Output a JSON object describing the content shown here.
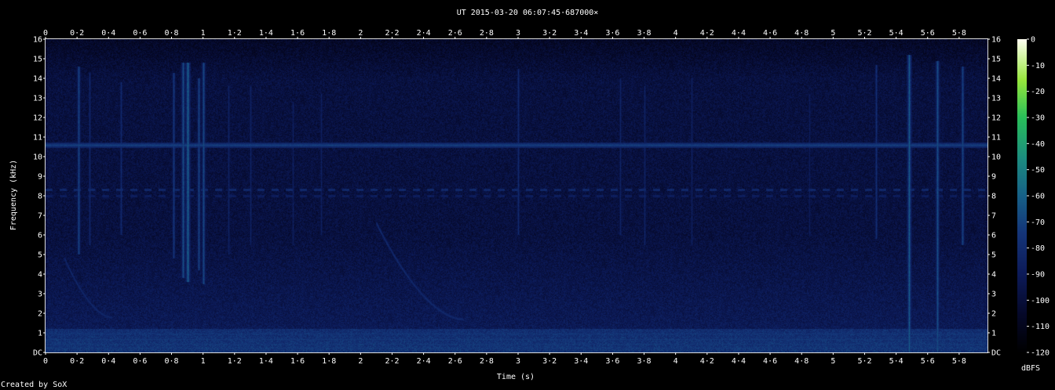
{
  "chart_data": {
    "type": "heatmap",
    "title": "UT 2015-03-20 06:07:45·687000×",
    "xlabel": "Time (s)",
    "ylabel": "Frequency (kHz)",
    "xlim": [
      0,
      5.98
    ],
    "ylim": [
      0,
      16
    ],
    "x_ticks": [
      "0",
      "0·2",
      "0·4",
      "0·6",
      "0·8",
      "1",
      "1·2",
      "1·4",
      "1·6",
      "1·8",
      "2",
      "2·2",
      "2·4",
      "2·6",
      "2·8",
      "3",
      "3·2",
      "3·4",
      "3·6",
      "3·8",
      "4",
      "4·2",
      "4·4",
      "4·6",
      "4·8",
      "5",
      "5·2",
      "5·4",
      "5·6",
      "5·8"
    ],
    "y_ticks": [
      "DC",
      "1",
      "2",
      "3",
      "4",
      "5",
      "6",
      "7",
      "8",
      "9",
      "10",
      "11",
      "12",
      "13",
      "14",
      "15",
      "16"
    ],
    "colorbar": {
      "label": "dBFS",
      "range": [
        -120,
        0
      ],
      "ticks": [
        "0",
        "-10",
        "-20",
        "-30",
        "-40",
        "-50",
        "-60",
        "-70",
        "-80",
        "-90",
        "-100",
        "-110",
        "-120"
      ]
    },
    "features": {
      "background_dbfs": -98,
      "carrier_line": {
        "freq_khz": 10.6,
        "level_dbfs": -72
      },
      "dashed_lines": [
        {
          "freq_khz": 8.3,
          "level_dbfs": -82
        },
        {
          "freq_khz": 8.0,
          "level_dbfs": -88
        }
      ],
      "low_band": {
        "freq_khz": [
          0,
          1.2
        ],
        "level_dbfs": -78
      },
      "vertical_bursts": [
        {
          "t": 0.21,
          "f_min": 5,
          "f_max": 14.6,
          "level_dbfs": -70
        },
        {
          "t": 0.28,
          "f_min": 5.5,
          "f_max": 14.3,
          "level_dbfs": -82
        },
        {
          "t": 0.48,
          "f_min": 6,
          "f_max": 13.8,
          "level_dbfs": -80
        },
        {
          "t": 0.81,
          "f_min": 4.8,
          "f_max": 14.3,
          "level_dbfs": -74
        },
        {
          "t": 0.87,
          "f_min": 3.8,
          "f_max": 14.8,
          "level_dbfs": -66
        },
        {
          "t": 0.9,
          "f_min": 3.6,
          "f_max": 14.8,
          "level_dbfs": -60
        },
        {
          "t": 0.97,
          "f_min": 4.2,
          "f_max": 14,
          "level_dbfs": -70
        },
        {
          "t": 1.0,
          "f_min": 3.5,
          "f_max": 14.8,
          "level_dbfs": -68
        },
        {
          "t": 1.16,
          "f_min": 5,
          "f_max": 13.6,
          "level_dbfs": -84
        },
        {
          "t": 1.3,
          "f_min": 5.5,
          "f_max": 13.6,
          "level_dbfs": -84
        },
        {
          "t": 1.57,
          "f_min": 5.5,
          "f_max": 12.8,
          "level_dbfs": -86
        },
        {
          "t": 1.75,
          "f_min": 6,
          "f_max": 13.2,
          "level_dbfs": -86
        },
        {
          "t": 3.0,
          "f_min": 6,
          "f_max": 14.5,
          "level_dbfs": -80
        },
        {
          "t": 3.65,
          "f_min": 6,
          "f_max": 14,
          "level_dbfs": -84
        },
        {
          "t": 3.8,
          "f_min": 5.5,
          "f_max": 13.6,
          "level_dbfs": -84
        },
        {
          "t": 4.1,
          "f_min": 5.5,
          "f_max": 14,
          "level_dbfs": -86
        },
        {
          "t": 4.85,
          "f_min": 6,
          "f_max": 13.2,
          "level_dbfs": -88
        },
        {
          "t": 5.27,
          "f_min": 5.8,
          "f_max": 14.7,
          "level_dbfs": -78
        },
        {
          "t": 5.48,
          "f_min": 0,
          "f_max": 15.2,
          "level_dbfs": -62
        },
        {
          "t": 5.66,
          "f_min": 0,
          "f_max": 14.9,
          "level_dbfs": -66
        },
        {
          "t": 5.82,
          "f_min": 5.5,
          "f_max": 14.6,
          "level_dbfs": -70
        }
      ],
      "sweeps": [
        {
          "t_start": 0.12,
          "t_end": 0.42,
          "f_start": 4.8,
          "f_end": 1.8,
          "level_dbfs": -84
        },
        {
          "t_start": 2.1,
          "t_end": 2.65,
          "f_start": 6.6,
          "f_end": 1.7,
          "level_dbfs": -82
        }
      ]
    }
  },
  "footer": {
    "credit": "Created by SoX"
  }
}
